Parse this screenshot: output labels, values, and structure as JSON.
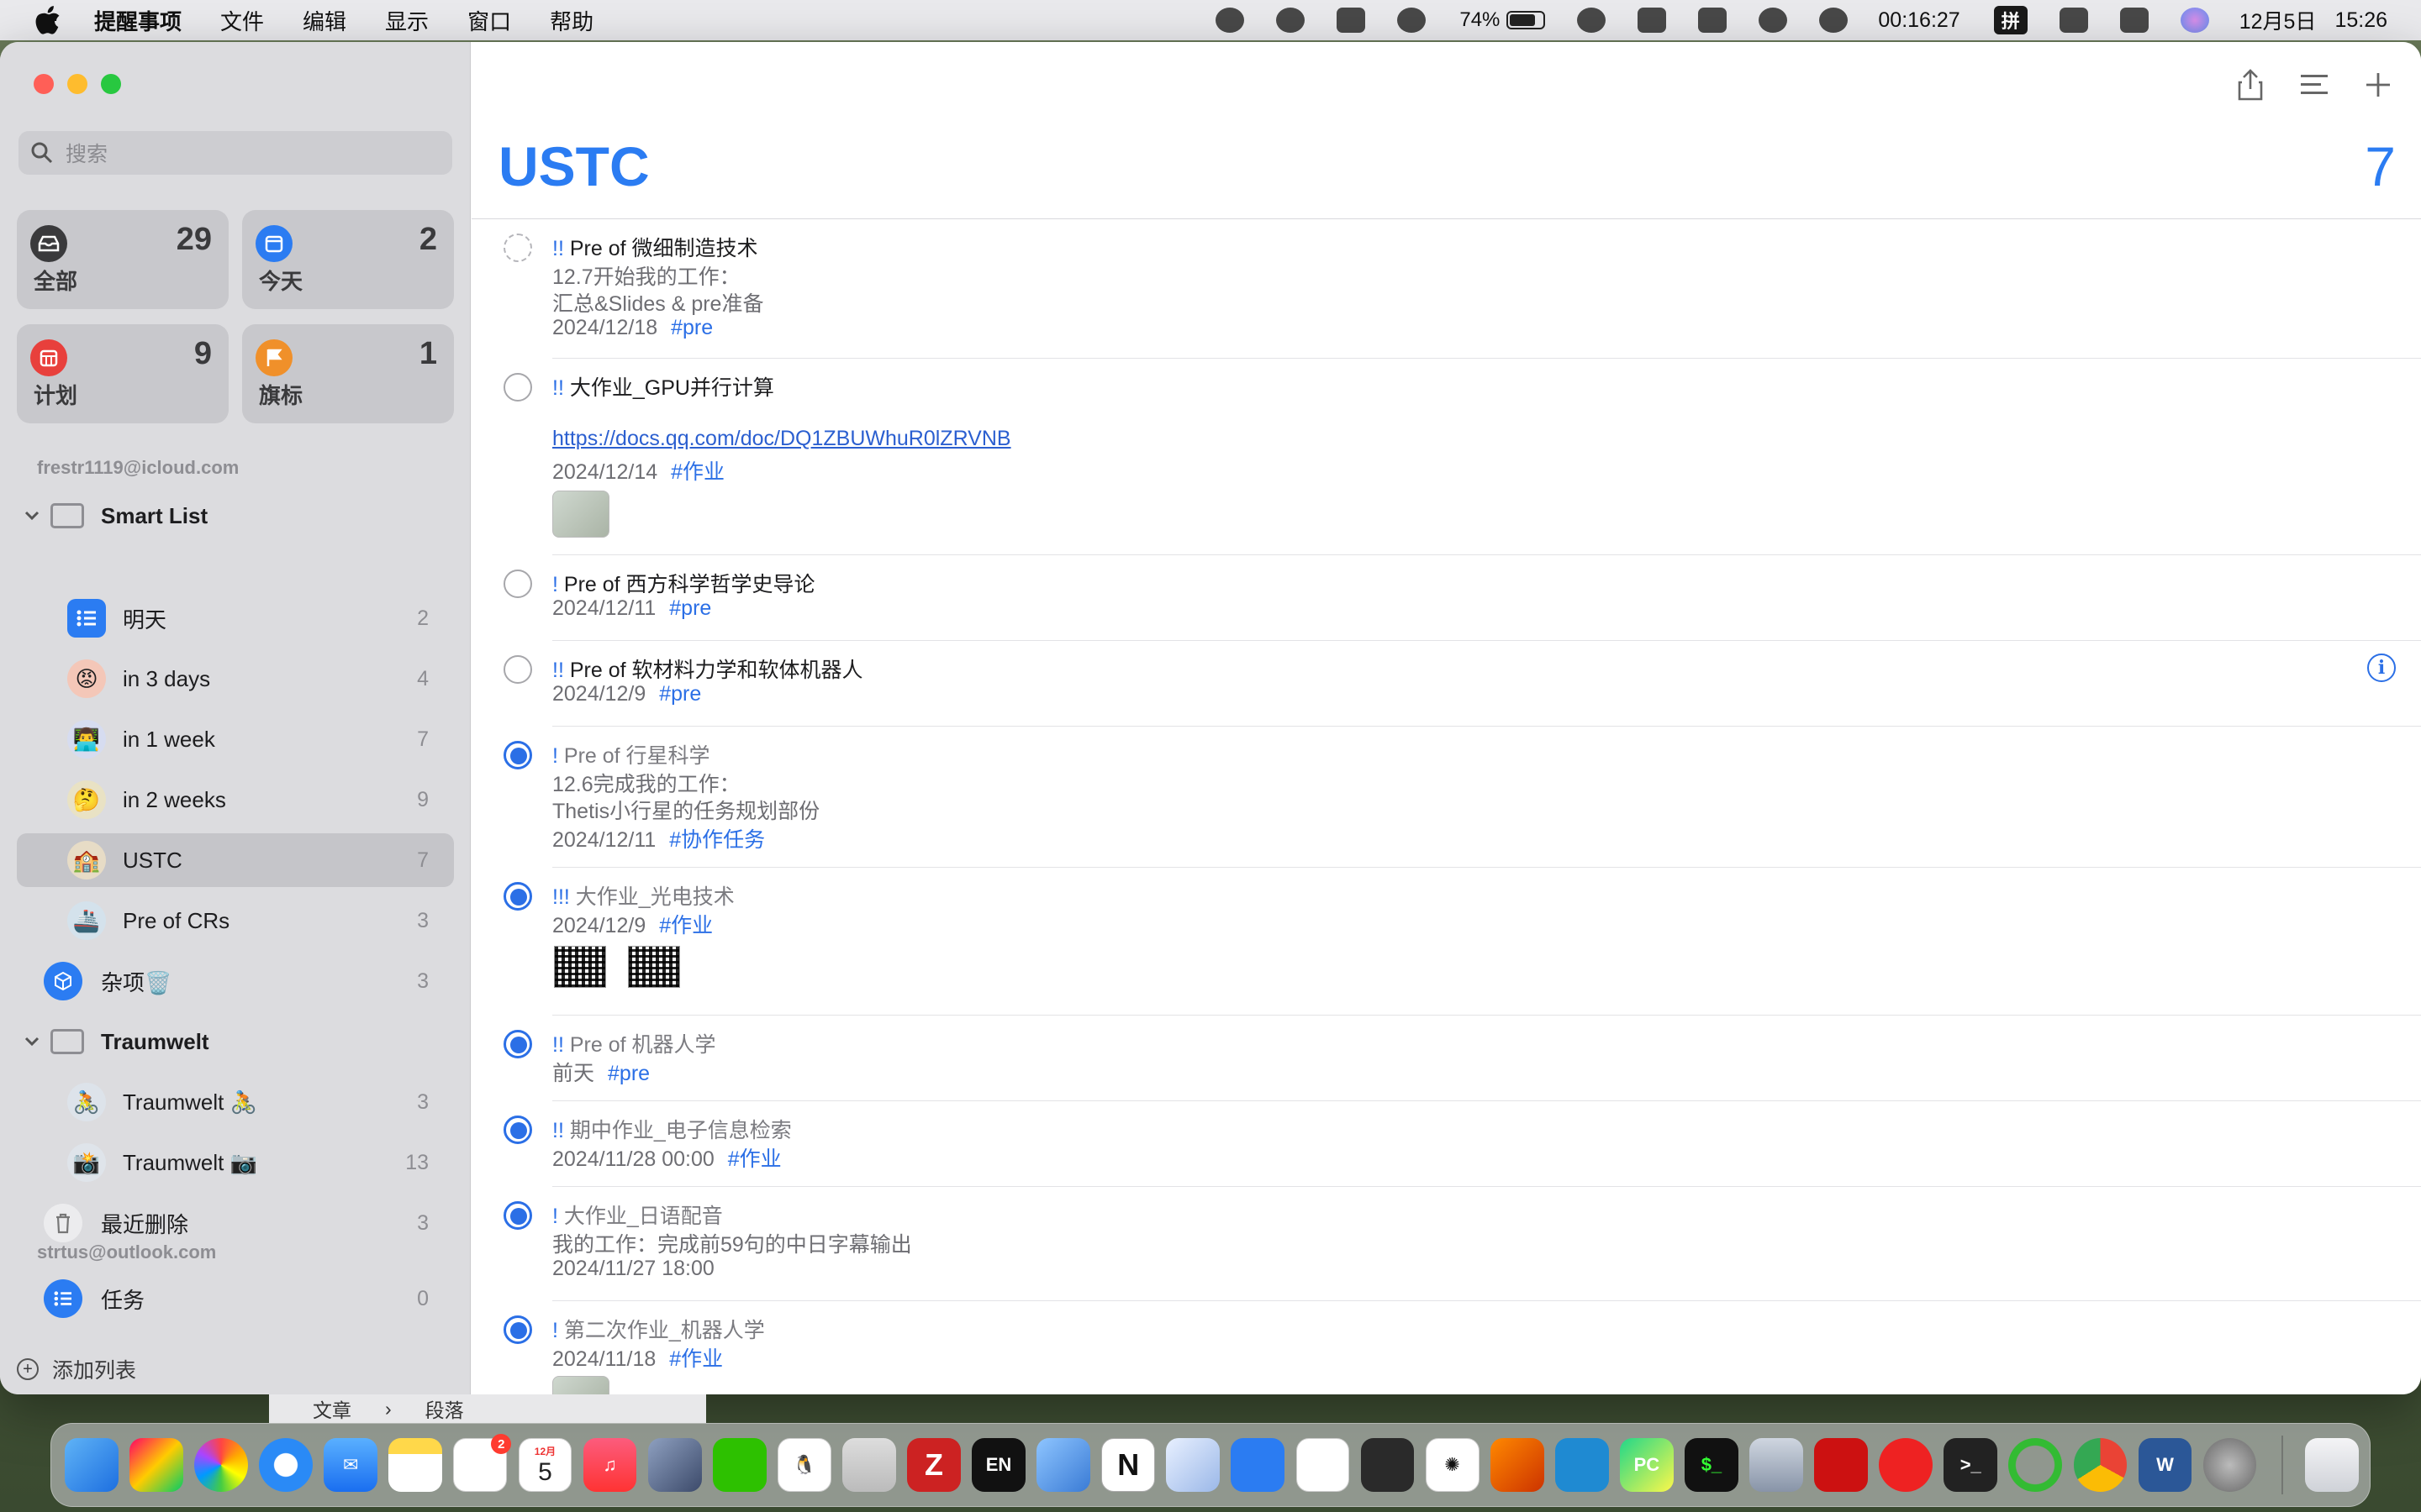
{
  "menubar": {
    "app_name": "提醒事项",
    "menus": [
      "文件",
      "编辑",
      "显示",
      "窗口",
      "帮助"
    ],
    "battery": "74%",
    "timer": "00:16:27",
    "ime": "拼",
    "date": "12月5日",
    "time": "15:26"
  },
  "sidebar": {
    "search_placeholder": "搜索",
    "tiles": [
      {
        "label": "全部",
        "count": "29",
        "icon": "tray-icon",
        "color": "#3a3a3c"
      },
      {
        "label": "今天",
        "count": "2",
        "icon": "calendar-icon",
        "color": "#2b7cf2"
      },
      {
        "label": "计划",
        "count": "9",
        "icon": "calendar-grid-icon",
        "color": "#e8403c"
      },
      {
        "label": "旗标",
        "count": "1",
        "icon": "flag-icon",
        "color": "#f0902a"
      }
    ],
    "account1": "frestr1119@icloud.com",
    "group1": {
      "label": "Smart List"
    },
    "group1_items": [
      {
        "label": "明天",
        "count": "2"
      },
      {
        "label": "in 3 days",
        "count": "4"
      },
      {
        "label": "in 1 week",
        "count": "7"
      },
      {
        "label": "in 2 weeks",
        "count": "9"
      },
      {
        "label": "USTC",
        "count": "7"
      },
      {
        "label": "Pre of CRs",
        "count": "3"
      }
    ],
    "misc": {
      "label": "杂项🗑️",
      "count": "3"
    },
    "group2": {
      "label": "Traumwelt"
    },
    "group2_items": [
      {
        "label": "Traumwelt 🚴",
        "count": "3"
      },
      {
        "label": "Traumwelt 📷",
        "count": "13"
      }
    ],
    "recently_deleted": {
      "label": "最近删除",
      "count": "3"
    },
    "account2": "strtus@outlook.com",
    "tasks": {
      "label": "任务",
      "count": "0"
    },
    "add_list": "添加列表"
  },
  "main": {
    "title": "USTC",
    "count": "7",
    "reminders": [
      {
        "prio": "!!",
        "title": " Pre of 微细制造技术",
        "lines": [
          "12.7开始我的工作：",
          "汇总&Slides & pre准备"
        ],
        "date": "2024/12/18",
        "tag": "#pre"
      },
      {
        "prio": "!!",
        "title": " 大作业_GPU并行计算",
        "link": "https://docs.qq.com/doc/DQ1ZBUWhuR0lZRVNB",
        "date": "2024/12/14",
        "tag": "#作业"
      },
      {
        "prio": "!",
        "title": " Pre of 西方科学哲学史导论",
        "date": "2024/12/11",
        "tag": "#pre"
      },
      {
        "prio": "!!",
        "title": " Pre of 软材料力学和软体机器人",
        "date": "2024/12/9",
        "tag": "#pre"
      },
      {
        "prio": "!",
        "title": " Pre of 行星科学",
        "lines": [
          "12.6完成我的工作：",
          "Thetis小行星的任务规划部份"
        ],
        "date": "2024/12/11",
        "tag": "#协作任务"
      },
      {
        "prio": "!!!",
        "title": " 大作业_光电技术",
        "date": "2024/12/9",
        "tag": "#作业"
      },
      {
        "prio": "!!",
        "title": " Pre of 机器人学",
        "date": "前天",
        "tag": "#pre"
      },
      {
        "prio": "!!",
        "title": " 期中作业_电子信息检索",
        "date": "2024/11/28 00:00",
        "tag": "#作业"
      },
      {
        "prio": "!",
        "title": " 大作业_日语配音",
        "lines": [
          "我的工作：完成前59句的中日字幕输出"
        ],
        "date": "2024/11/27 18:00",
        "tag": ""
      },
      {
        "prio": "!",
        "title": " 第二次作业_机器人学",
        "date": "2024/11/18",
        "tag": "#作业"
      }
    ]
  },
  "under_strip": {
    "crumb1": "文章",
    "crumb2": "段落"
  },
  "dock": {
    "reminders_badge": "2",
    "calendar_month": "12月",
    "calendar_day": "5"
  }
}
